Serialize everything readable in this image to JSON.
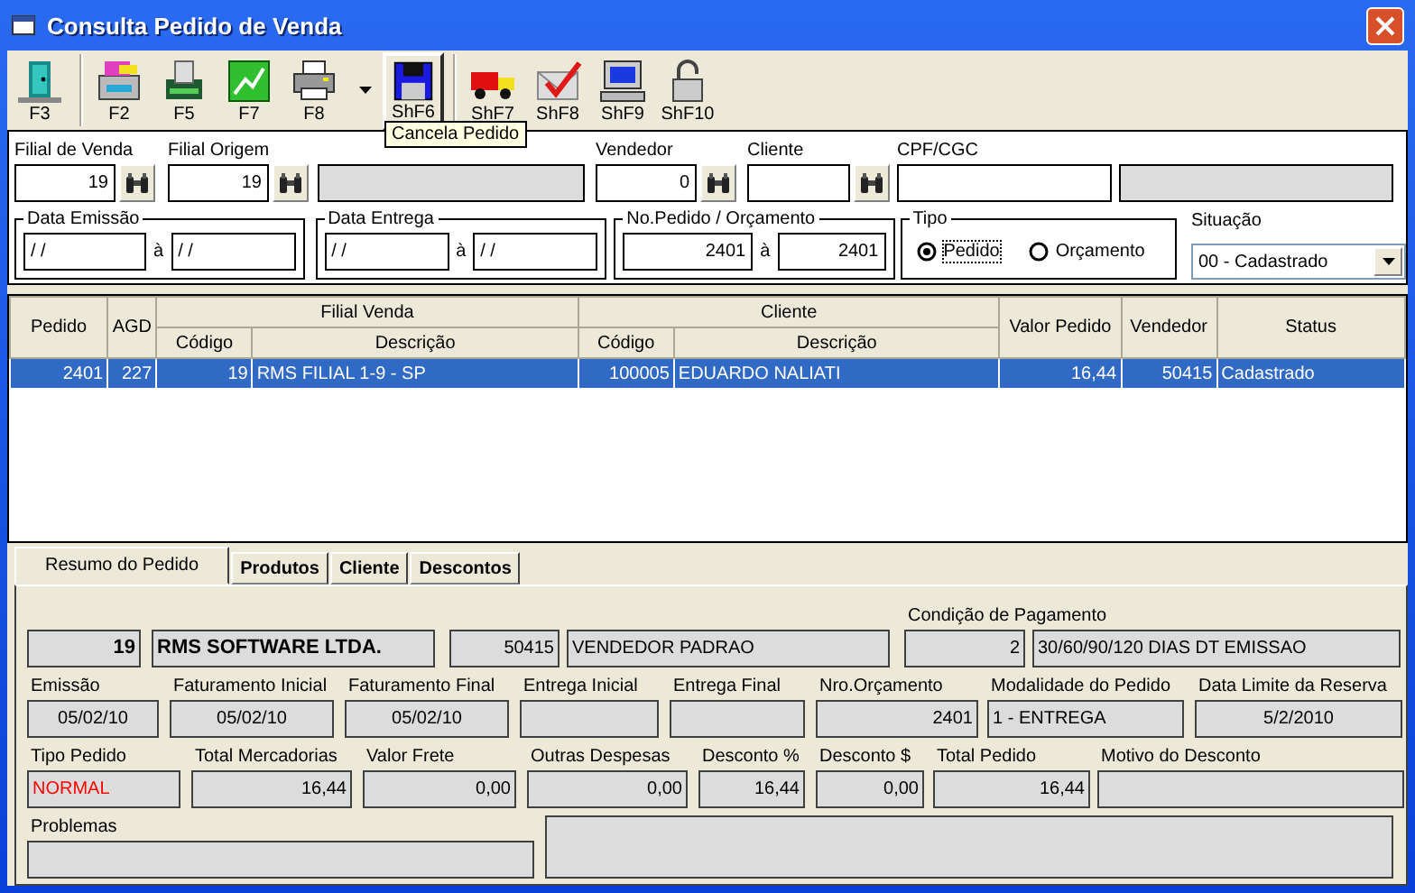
{
  "window": {
    "title": "Consulta Pedido de Venda"
  },
  "toolbar": {
    "groups": [
      {
        "buttons": [
          {
            "label": "F3",
            "hovered": false,
            "menu_arrow": false
          }
        ]
      },
      {
        "buttons": [
          {
            "label": "F2",
            "hovered": false,
            "menu_arrow": false
          },
          {
            "label": "F5",
            "hovered": false,
            "menu_arrow": false
          },
          {
            "label": "F7",
            "hovered": false,
            "menu_arrow": false
          },
          {
            "label": "F8",
            "hovered": false,
            "menu_arrow": true
          },
          {
            "label": "ShF6",
            "hovered": true,
            "menu_arrow": false
          }
        ]
      },
      {
        "buttons": [
          {
            "label": "ShF7",
            "hovered": false,
            "menu_arrow": false
          },
          {
            "label": "ShF8",
            "hovered": false,
            "menu_arrow": false
          },
          {
            "label": "ShF9",
            "hovered": false,
            "menu_arrow": false
          },
          {
            "label": "ShF10",
            "hovered": false,
            "menu_arrow": false
          }
        ]
      }
    ],
    "tooltip": "Cancela Pedido"
  },
  "filters": {
    "fields": [
      {
        "kind": "input",
        "label": "Filial de Venda",
        "value": "19",
        "lookup": true
      },
      {
        "kind": "input",
        "label": "Filial Origem",
        "value": "19",
        "lookup": true
      },
      {
        "kind": "readonly",
        "lookup": false
      },
      {
        "kind": "input",
        "label": "Vendedor",
        "value": "0",
        "lookup": true
      },
      {
        "kind": "input",
        "label": "Cliente",
        "lookup": true
      },
      {
        "kind": "input",
        "label": "CPF/CGC",
        "lookup": false
      },
      {
        "kind": "readonly",
        "lookup": false
      }
    ],
    "ranges": [
      {
        "label": "Data Emissão",
        "from": "/ /",
        "separator": "à",
        "to": "/ /"
      },
      {
        "label": "Data Entrega",
        "from": "/ /",
        "separator": "à",
        "to": "/ /"
      },
      {
        "label": "No.Pedido / Orçamento",
        "from": "2401",
        "separator": "à",
        "to": "2401"
      }
    ],
    "tipo": {
      "label": "Tipo",
      "options": [
        {
          "label": "Pedido",
          "selected": true
        },
        {
          "label": "Orçamento",
          "selected": false
        }
      ]
    },
    "situacao": {
      "label": "Situação",
      "value": "00 - Cadastrado"
    }
  },
  "table": {
    "column_groups": [
      {
        "label": "Pedido"
      },
      {
        "label": "AGD"
      },
      {
        "label": "Filial Venda",
        "columns": [
          "Código",
          "Descrição"
        ]
      },
      {
        "label": "Cliente",
        "columns": [
          "Código",
          "Descrição"
        ]
      },
      {
        "label": "Valor Pedido"
      },
      {
        "label": "Vendedor"
      },
      {
        "label": "Status"
      }
    ],
    "rows": [
      {
        "selected": true,
        "cells": [
          "2401",
          "227",
          "19",
          "RMS FILIAL 1-9 - SP",
          "100005",
          "EDUARDO NALIATI",
          "16,44",
          "50415",
          "Cadastrado"
        ]
      }
    ]
  },
  "tabs": [
    {
      "label": "Resumo do Pedido",
      "selected": true
    },
    {
      "label": "Produtos",
      "selected": false
    },
    {
      "label": "Cliente",
      "selected": false
    },
    {
      "label": "Descontos",
      "selected": false
    }
  ],
  "summary": {
    "rows": [
      {
        "fields": [
          {
            "value": "19"
          },
          {
            "value": "RMS SOFTWARE LTDA."
          },
          {
            "value": "50415"
          },
          {
            "value": "VENDEDOR PADRAO"
          },
          {
            "label": "Condição de Pagamento",
            "value": "2"
          },
          {
            "value": "30/60/90/120 DIAS DT EMISSAO"
          }
        ]
      },
      {
        "fields": [
          {
            "label": "Emissão",
            "value": "05/02/10"
          },
          {
            "label": "Faturamento Inicial",
            "value": "05/02/10"
          },
          {
            "label": "Faturamento Final",
            "value": "05/02/10"
          },
          {
            "label": "Entrega Inicial"
          },
          {
            "label": "Entrega Final"
          },
          {
            "label": "Nro.Orçamento",
            "value": "2401"
          },
          {
            "label": "Modalidade do Pedido",
            "value": "1 - ENTREGA"
          },
          {
            "label": "Data Limite da Reserva",
            "value": "5/2/2010"
          }
        ]
      },
      {
        "fields": [
          {
            "label": "Tipo Pedido",
            "value": "NORMAL",
            "color": "#ff0000"
          },
          {
            "label": "Total Mercadorias",
            "value": "16,44"
          },
          {
            "label": "Valor Frete",
            "value": "0,00"
          },
          {
            "label": "Outras Despesas",
            "value": "0,00"
          },
          {
            "label": "Desconto %",
            "value": "16,44"
          },
          {
            "label": "Desconto $",
            "value": "0,00"
          },
          {
            "label": "Total Pedido",
            "value": "16,44"
          },
          {
            "label": "Motivo do Desconto"
          }
        ]
      },
      {
        "fields": [
          {
            "kind": "field",
            "label": "Problemas"
          },
          {
            "kind": "memo"
          }
        ]
      }
    ]
  }
}
